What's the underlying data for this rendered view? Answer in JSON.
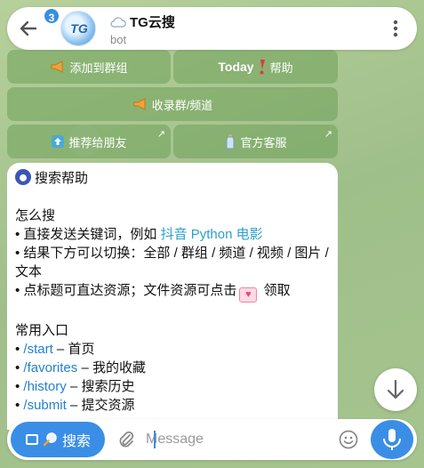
{
  "header": {
    "badge_count": "3",
    "avatar_text": "TG",
    "title": "TG云搜",
    "subtitle": "bot"
  },
  "keyboard": {
    "add_to_group": "添加到群组",
    "today_word": "Today",
    "help": "帮助",
    "index_group": "收录群/频道",
    "recommend": "推荐给朋友",
    "support": "官方客服"
  },
  "message": {
    "title": "搜索帮助",
    "section1_title": "怎么搜",
    "l1_prefix": "• 直接发送关键词，例如 ",
    "l1_keywords": "抖音 Python 电影",
    "l2": "• 结果下方可以切换：全部 / 群组 / 频道 / 视频 / 图片 / 文本",
    "l3_prefix": "• 点标题可直达资源；文件资源可点击",
    "l3_suffix": " 领取",
    "section2_title": "常用入口",
    "cmd1": "/start",
    "cmd1_desc": " – 首页",
    "cmd2": "/favorites",
    "cmd2_desc": " – 我的收藏",
    "cmd3": "/history",
    "cmd3_desc": " – 搜索历史",
    "cmd4": "/submit",
    "cmd4_desc": " – 提交资源",
    "bullet": "• "
  },
  "input_bar": {
    "search_label": "搜索",
    "placeholder": "Message"
  },
  "colors": {
    "accent": "#3a8ee6",
    "link": "#2481cc",
    "keyboard_bg": "#8cb56e"
  },
  "icons": [
    "back-arrow-icon",
    "more-vertical-icon",
    "megaphone-icon",
    "up-arrow-icon",
    "bottle-icon",
    "share-arrow-icon",
    "owl-icon",
    "gift-icon",
    "chevron-down-icon",
    "keyboard-icon",
    "magnifier-icon",
    "paperclip-icon",
    "smile-icon",
    "microphone-icon"
  ]
}
